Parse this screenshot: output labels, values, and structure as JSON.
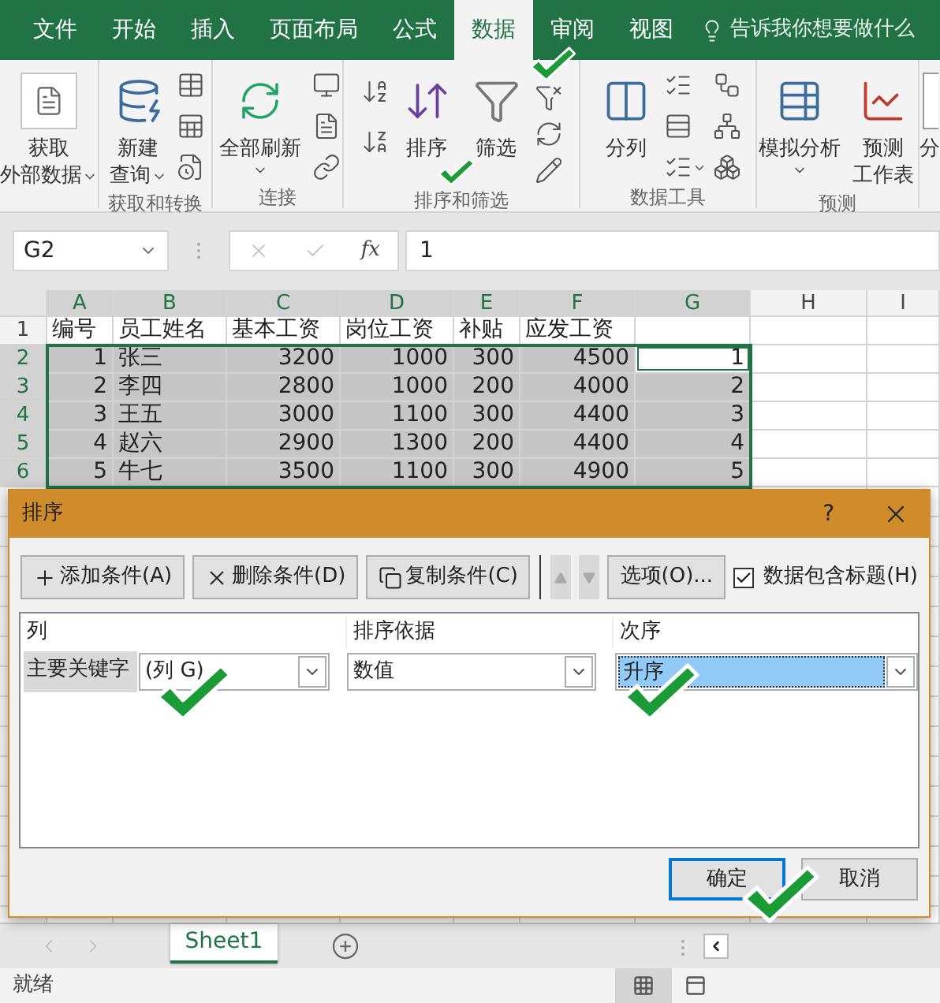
{
  "tabs": [
    {
      "label": "文件",
      "selected": false
    },
    {
      "label": "开始",
      "selected": false
    },
    {
      "label": "插入",
      "selected": false
    },
    {
      "label": "页面布局",
      "selected": false
    },
    {
      "label": "公式",
      "selected": false
    },
    {
      "label": "数据",
      "selected": true
    },
    {
      "label": "审阅",
      "selected": false
    },
    {
      "label": "视图",
      "selected": false
    }
  ],
  "tell_me": {
    "placeholder": "告诉我你想要做什么"
  },
  "ribbon": {
    "groups": [
      {
        "buttons": [
          {
            "label": [
              "获取",
              "外部数据"
            ],
            "dropdown": true
          }
        ]
      },
      {
        "label": "获取和转换",
        "buttons": [
          {
            "label": [
              "新建",
              "查询"
            ],
            "dropdown": true
          }
        ]
      },
      {
        "label": "连接",
        "buttons": [
          {
            "label": [
              "全部刷新"
            ],
            "dropdown": true
          }
        ]
      },
      {
        "label": "排序和筛选",
        "buttons": [
          {
            "label": [
              "排序"
            ],
            "dropdown": false
          },
          {
            "label": [
              "筛选"
            ],
            "dropdown": false
          }
        ]
      },
      {
        "label": "数据工具",
        "buttons": [
          {
            "label": [
              "分列"
            ],
            "dropdown": false
          }
        ]
      },
      {
        "label": "预测",
        "buttons": [
          {
            "label": [
              "模拟分析"
            ],
            "dropdown": true
          },
          {
            "label": [
              "预测",
              "工作表"
            ],
            "dropdown": false
          }
        ]
      },
      {
        "buttons": [
          {
            "label": [
              "分"
            ],
            "dropdown": false
          }
        ]
      }
    ]
  },
  "formula_bar": {
    "name_box": "G2",
    "function_button": "fx",
    "formula": "1"
  },
  "sheet": {
    "columns": [
      {
        "label": "A",
        "selected": true
      },
      {
        "label": "B",
        "selected": true
      },
      {
        "label": "C",
        "selected": true
      },
      {
        "label": "D",
        "selected": true
      },
      {
        "label": "E",
        "selected": true
      },
      {
        "label": "F",
        "selected": true
      },
      {
        "label": "G",
        "selected": true
      },
      {
        "label": "H",
        "selected": false
      },
      {
        "label": "I",
        "selected": false
      }
    ],
    "rows": [
      {
        "header": "1",
        "kind": "header",
        "selected": false,
        "number": "编号",
        "name": "员工姓名",
        "base_pay": "基本工资",
        "post_pay": "岗位工资",
        "allowance": "补贴",
        "gross_pay": "应发工资"
      },
      {
        "header": "2",
        "kind": "data",
        "selected": true,
        "number": "1",
        "name": "张三",
        "base_pay": "3200",
        "post_pay": "1000",
        "allowance": "300",
        "gross_pay": "4500",
        "column_g": {
          "text": "1",
          "active": true
        }
      },
      {
        "header": "3",
        "kind": "data",
        "selected": true,
        "number": "2",
        "name": "李四",
        "base_pay": "2800",
        "post_pay": "1000",
        "allowance": "200",
        "gross_pay": "4000",
        "column_g": {
          "text": "2",
          "active": false
        }
      },
      {
        "header": "4",
        "kind": "data",
        "selected": true,
        "number": "3",
        "name": "王五",
        "base_pay": "3000",
        "post_pay": "1100",
        "allowance": "300",
        "gross_pay": "4400",
        "column_g": {
          "text": "3",
          "active": false
        }
      },
      {
        "header": "5",
        "kind": "data",
        "selected": true,
        "number": "4",
        "name": "赵六",
        "base_pay": "2900",
        "post_pay": "1300",
        "allowance": "200",
        "gross_pay": "4400",
        "column_g": {
          "text": "4",
          "active": false
        }
      },
      {
        "header": "6",
        "kind": "data",
        "selected": true,
        "number": "5",
        "name": "牛七",
        "base_pay": "3500",
        "post_pay": "1100",
        "allowance": "300",
        "gross_pay": "4900",
        "column_g": {
          "text": "5",
          "active": false
        }
      }
    ]
  },
  "dialog": {
    "title": "排序",
    "help": "?",
    "toolbar": [
      {
        "kind": "add",
        "label": "添加条件(A)",
        "disabled": false
      },
      {
        "kind": "delete",
        "label": "删除条件(D)",
        "disabled": false
      },
      {
        "kind": "copy",
        "label": "复制条件(C)",
        "disabled": false
      },
      {
        "kind": "up",
        "disabled": true
      },
      {
        "kind": "down",
        "disabled": true
      },
      {
        "kind": "options",
        "label": "选项(O)...",
        "disabled": false
      }
    ],
    "header_checkbox": {
      "label": "数据包含标题(H)",
      "checked": true
    },
    "columns": [
      "列",
      "排序依据",
      "次序"
    ],
    "levels": [
      {
        "label": "主要关键字",
        "fields": [
          {
            "value": "(列 G)",
            "focused": false
          },
          {
            "value": "数值",
            "focused": false
          },
          {
            "value": "升序",
            "focused": true
          }
        ]
      }
    ],
    "buttons": [
      {
        "label": "确定",
        "default": true
      },
      {
        "label": "取消",
        "default": false
      }
    ]
  },
  "sheet_tabs": [
    {
      "label": "Sheet1",
      "selected": true
    }
  ],
  "status_bar": {
    "text": "就绪"
  }
}
